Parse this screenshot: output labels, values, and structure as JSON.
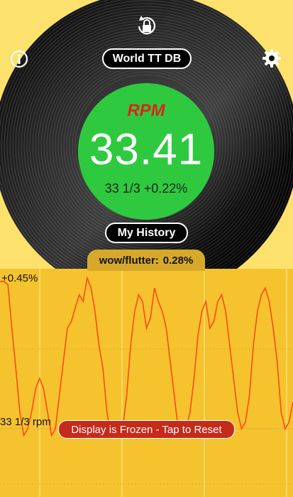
{
  "header": {
    "db_button_label": "World TT DB",
    "history_button_label": "My History"
  },
  "icons": {
    "lock": "lock-rotate-icon",
    "info": "info-icon",
    "settings": "gear-icon"
  },
  "meter": {
    "label": "RPM",
    "value": "33.41",
    "reference_text": "33 1/3 +0.22%",
    "accent_color": "#2fc93f",
    "label_color": "#d9261c"
  },
  "graph": {
    "wow_flutter_label": "wow/flutter:",
    "wow_flutter_value": "0.28%",
    "top_label": "+0.45%",
    "reference_label": "33 1/3 rpm",
    "line_color": "#ff4a14",
    "trace": [
      0.44,
      0.44,
      0.43,
      0.3,
      0.18,
      0.05,
      -0.02,
      0.0,
      0.05,
      0.12,
      0.15,
      0.12,
      0.05,
      -0.02,
      0.0,
      0.1,
      0.2,
      0.3,
      0.32,
      0.36,
      0.4,
      0.38,
      0.45,
      0.42,
      0.35,
      0.25,
      0.18,
      0.05,
      -0.02,
      0.0,
      0.02,
      0.0,
      0.1,
      0.25,
      0.35,
      0.4,
      0.38,
      0.3,
      0.33,
      0.42,
      0.38,
      0.35,
      0.3,
      0.2,
      0.1,
      0.0,
      -0.02,
      0.0,
      0.05,
      0.15,
      0.28,
      0.35,
      0.38,
      0.3,
      0.32,
      0.38,
      0.4,
      0.35,
      0.25,
      0.15,
      0.05,
      0.0,
      0.02,
      0.1,
      0.25,
      0.35,
      0.4,
      0.42,
      0.38,
      0.3,
      0.2,
      0.05,
      0.0,
      0.02,
      0.08
    ]
  },
  "status": {
    "frozen_text": "Display is Frozen - Tap to Reset"
  }
}
